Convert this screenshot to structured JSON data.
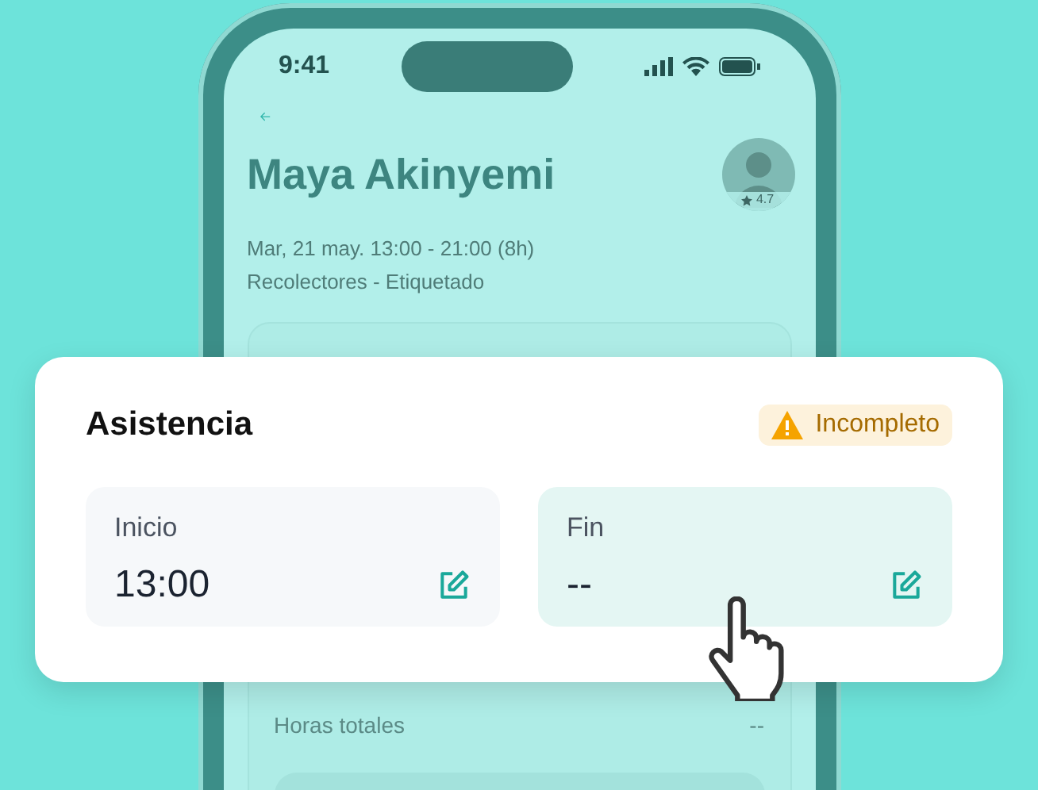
{
  "status_bar": {
    "time": "9:41"
  },
  "profile": {
    "name": "Maya Akinyemi",
    "rating": "4.7",
    "shift": "Mar, 21 may. 13:00 - 21:00 (8h)",
    "role": "Recolectores - Etiquetado"
  },
  "summary": {
    "label": "Horas totales",
    "value": "--"
  },
  "attendance": {
    "title": "Asistencia",
    "status": {
      "kind": "warning",
      "label": "Incompleto"
    },
    "fields": [
      {
        "label": "Inicio",
        "value": "13:00",
        "selected": false
      },
      {
        "label": "Fin",
        "value": "--",
        "selected": true
      }
    ]
  }
}
